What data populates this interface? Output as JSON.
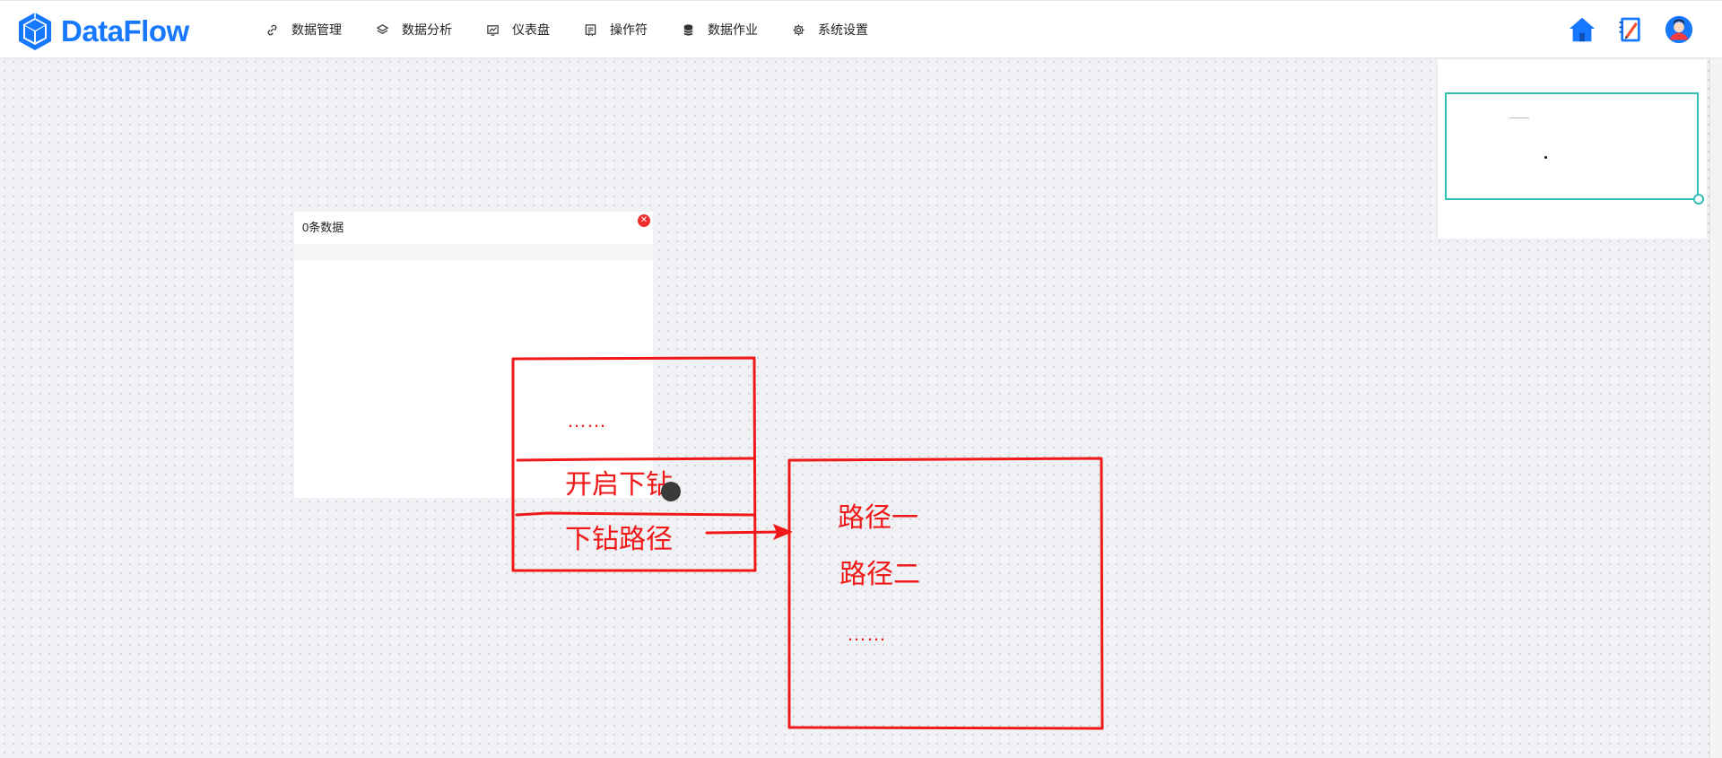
{
  "app": {
    "brand": "DataFlow",
    "brand_color": "#1677ff"
  },
  "nav": [
    {
      "label": "数据管理",
      "icon": "link-icon"
    },
    {
      "label": "数据分析",
      "icon": "layers-icon"
    },
    {
      "label": "仪表盘",
      "icon": "dashboard-icon"
    },
    {
      "label": "操作符",
      "icon": "operator-icon"
    },
    {
      "label": "数据作业",
      "icon": "database-icon"
    },
    {
      "label": "系统设置",
      "icon": "gear-icon"
    }
  ],
  "header_right": {
    "icons": [
      "home-icon",
      "notebook-icon",
      "user-avatar-icon"
    ]
  },
  "node_card": {
    "title": "0条数据",
    "close_icon": "close-icon"
  },
  "annotations": {
    "menu_box": {
      "dots": "……",
      "item1": "开启下钻",
      "item2": "下钻路径"
    },
    "path_box": {
      "path1": "路径一",
      "path2": "路径二",
      "dots": "……"
    },
    "color": "#f01818"
  },
  "colors": {
    "minimap_border": "#2fc2b4",
    "close_button": "#f02c2c"
  }
}
